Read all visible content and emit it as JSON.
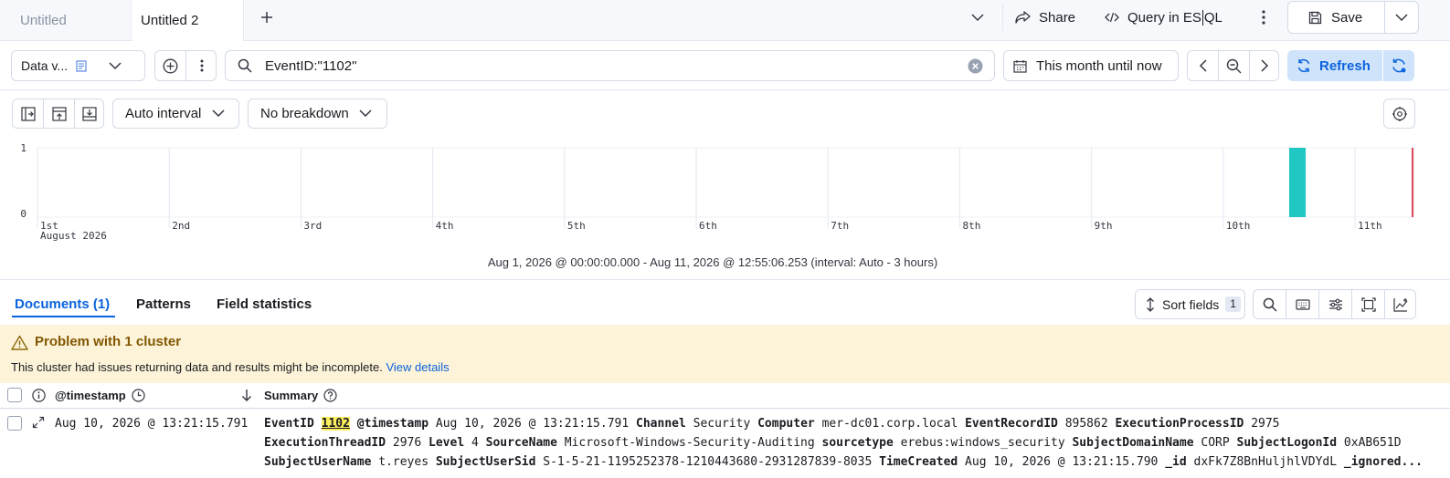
{
  "tabs": [
    {
      "label": "Untitled"
    },
    {
      "label": "Untitled 2"
    }
  ],
  "top_actions": {
    "share": "Share",
    "query_esql_prefix": "Query in ES",
    "query_esql_suffix": "QL",
    "save": "Save"
  },
  "query_bar": {
    "data_view": "Data v...",
    "query": "EventID:\"1102\"",
    "time_range": "This month until now",
    "refresh": "Refresh"
  },
  "chart_controls": {
    "interval": "Auto interval",
    "breakdown": "No breakdown"
  },
  "chart_data": {
    "type": "bar",
    "y_ticks": [
      "1",
      "0"
    ],
    "x_ticks": [
      "1st",
      "2nd",
      "3rd",
      "4th",
      "5th",
      "6th",
      "7th",
      "8th",
      "9th",
      "10th",
      "11th"
    ],
    "x_sublabel": "August 2026",
    "bars": [
      {
        "x": "Aug 10, 2026 @ 12:00",
        "value": 1
      }
    ],
    "ylim": [
      0,
      1
    ],
    "bar_color": "#20c7c3",
    "now_marker_color": "#e0465a"
  },
  "time_summary": "Aug 1, 2026 @ 00:00:00.000 - Aug 11, 2026 @ 12:55:06.253 (interval: Auto - 3 hours)",
  "doc_tabs": {
    "documents": "Documents (1)",
    "patterns": "Patterns",
    "field_statistics": "Field statistics",
    "sort_fields": "Sort fields",
    "sort_count": "1"
  },
  "warning": {
    "title": "Problem with 1 cluster",
    "message": "This cluster had issues returning data and results might be incomplete.",
    "link": "View details"
  },
  "table": {
    "col_timestamp": "@timestamp",
    "col_summary": "Summary",
    "row": {
      "timestamp": "Aug 10, 2026 @ 13:21:15.791",
      "fields": [
        {
          "k": "EventID",
          "v": "1102"
        },
        {
          "k": "@timestamp",
          "v": "Aug 10, 2026 @ 13:21:15.791"
        },
        {
          "k": "Channel",
          "v": "Security"
        },
        {
          "k": "Computer",
          "v": "mer-dc01.corp.local"
        },
        {
          "k": "EventRecordID",
          "v": "895862"
        },
        {
          "k": "ExecutionProcessID",
          "v": "2975"
        },
        {
          "k": "ExecutionThreadID",
          "v": "2976"
        },
        {
          "k": "Level",
          "v": "4"
        },
        {
          "k": "SourceName",
          "v": "Microsoft-Windows-Security-Auditing"
        },
        {
          "k": "sourcetype",
          "v": "erebus:windows_security"
        },
        {
          "k": "SubjectDomainName",
          "v": "CORP"
        },
        {
          "k": "SubjectLogonId",
          "v": "0xAB651D"
        },
        {
          "k": "SubjectUserName",
          "v": "t.reyes"
        },
        {
          "k": "SubjectUserSid",
          "v": "S-1-5-21-1195252378-1210443680-2931287839-8035"
        },
        {
          "k": "TimeCreated",
          "v": "Aug 10, 2026 @ 13:21:15.790"
        },
        {
          "k": "_id",
          "v": "dxFk7Z8BnHuljhlVDYdL"
        },
        {
          "k": "_ignored",
          "v": "..."
        }
      ]
    }
  }
}
